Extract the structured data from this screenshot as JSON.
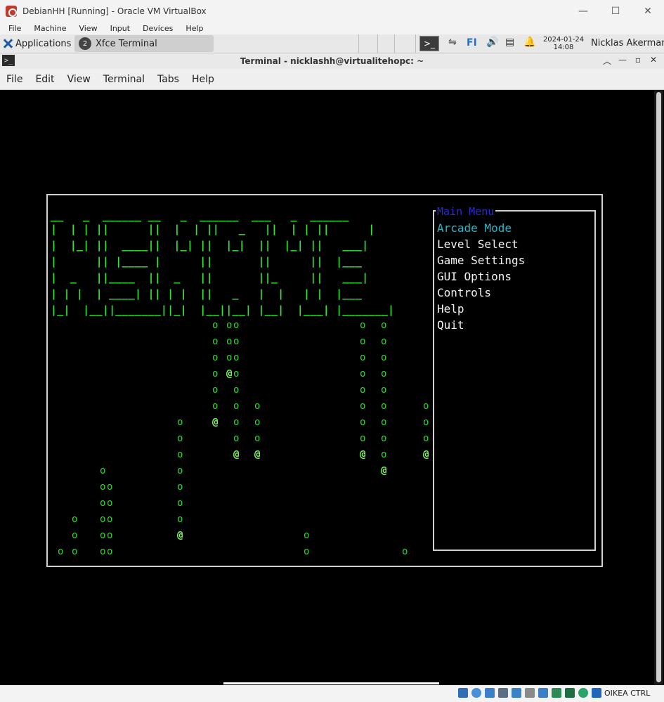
{
  "vbox": {
    "title": "DebianHH [Running] - Oracle VM VirtualBox",
    "menu": [
      "File",
      "Machine",
      "View",
      "Input",
      "Devices",
      "Help"
    ],
    "window_controls": {
      "minimize": "—",
      "maximize": "☐",
      "close": "✕"
    },
    "host_key": "OIKEA CTRL"
  },
  "panel": {
    "applications_label": "Applications",
    "task_badge": "2",
    "task_label": "Xfce Terminal",
    "terminal_launcher": ">_",
    "keyboard_layout": "FI",
    "clock_date": "2024-01-24",
    "clock_time": "14:08",
    "user": "Nicklas Akerman"
  },
  "terminal": {
    "title": "Terminal - nicklashh@virtualitehopc: ~",
    "menu": [
      "File",
      "Edit",
      "View",
      "Terminal",
      "Tabs",
      "Help"
    ]
  },
  "game": {
    "logo_lines": [
      "__   _  ______ __   _  ______  ___   _  ______",
      "|  | | ||      ||  |  | ||   _   ||  | | ||      |",
      "|  |_| ||  ____||  |_| ||  |_|  ||  |_| ||   ___|",
      "|      || |____ |      ||       ||      ||  |___",
      "|  _   ||____  ||  _   ||       ||_     ||   ___|",
      "| | |  | ____| || | |  ||   _   |  |   | |  |___",
      "|_|  |__||_______||_|  |__||__| |__|  |___| |_______|"
    ],
    "ball": "o",
    "player": "@",
    "main_menu": {
      "title": "Main Menu",
      "items": [
        "Arcade Mode",
        "Level Select",
        "Game Settings",
        "GUI Options",
        "Controls",
        "Help",
        "Quit"
      ],
      "selected": "Arcade Mode"
    }
  },
  "colors": {
    "logo": "#2ee62e",
    "menu_title": "#2a2adb",
    "menu_selected": "#2ab7c8",
    "menu_text": "#f2f2f2"
  }
}
